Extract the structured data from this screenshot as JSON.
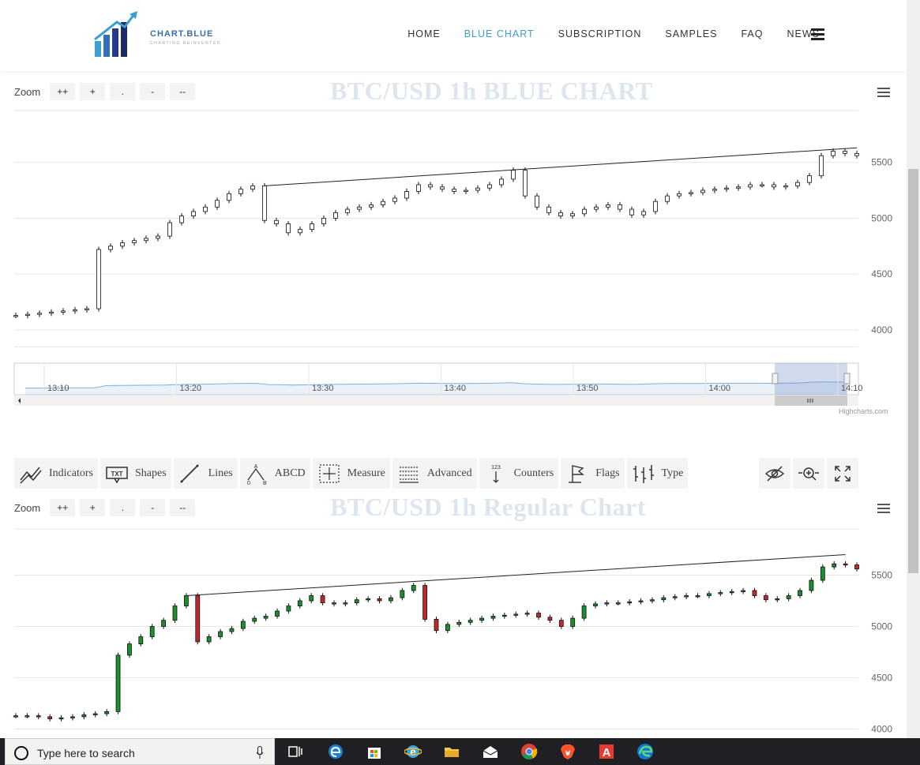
{
  "nav": {
    "logo_text": "CHART.BLUE",
    "logo_tagline": "CHARTING REINVENTED",
    "items": [
      {
        "label": "HOME",
        "active": false
      },
      {
        "label": "BLUE CHART",
        "active": true
      },
      {
        "label": "SUBSCRIPTION",
        "active": false
      },
      {
        "label": "SAMPLES",
        "active": false
      },
      {
        "label": "FAQ",
        "active": false
      },
      {
        "label": "NEWS",
        "active": false
      }
    ]
  },
  "zoom": {
    "label": "Zoom",
    "buttons": [
      "++",
      "+",
      ".",
      "-",
      "--"
    ]
  },
  "toolbar": {
    "items": [
      {
        "label": "Indicators",
        "icon": "indicators-icon"
      },
      {
        "label": "Shapes",
        "icon": "shapes-txt-icon",
        "icon_text": "TXT"
      },
      {
        "label": "Lines",
        "icon": "line-icon"
      },
      {
        "label": "ABCD",
        "icon": "abcd-icon"
      },
      {
        "label": "Measure",
        "icon": "measure-icon"
      },
      {
        "label": "Advanced",
        "icon": "advanced-icon"
      },
      {
        "label": "Counters",
        "icon": "counters-icon",
        "icon_text": "123"
      },
      {
        "label": "Flags",
        "icon": "flag-icon"
      },
      {
        "label": "Type",
        "icon": "type-icon"
      }
    ],
    "right_icons": [
      "hide-icon",
      "zoom-in-icon",
      "fullscreen-icon"
    ]
  },
  "credits": "Highcharts.com",
  "taskbar": {
    "search_placeholder": "Type here to search"
  },
  "chart_data": [
    {
      "type": "line",
      "title": "BTC/USD 1h BLUE CHART",
      "yticks": [
        4000,
        4500,
        5000,
        5500
      ],
      "ylim": [
        3950,
        5950
      ],
      "grid": true,
      "navigator_ticks": [
        "13:10",
        "13:20",
        "13:30",
        "13:40",
        "13:50",
        "14:00",
        "14:10"
      ],
      "series": [
        {
          "values": [
            4130,
            4140,
            4150,
            4160,
            4170,
            4180,
            4190,
            4720,
            4750,
            4780,
            4800,
            4820,
            4840,
            4960,
            5020,
            5060,
            5100,
            5160,
            5220,
            5260,
            5290,
            4980,
            4950,
            4870,
            4900,
            4950,
            5000,
            5050,
            5080,
            5100,
            5120,
            5150,
            5180,
            5240,
            5300,
            5280,
            5260,
            5240,
            5250,
            5270,
            5300,
            5350,
            5430,
            5200,
            5100,
            5050,
            5020,
            5040,
            5080,
            5100,
            5120,
            5080,
            5030,
            5060,
            5150,
            5200,
            5220,
            5230,
            5250,
            5260,
            5270,
            5280,
            5300,
            5300,
            5280,
            5290,
            5320,
            5380,
            5560,
            5600,
            5580,
            5560
          ]
        }
      ],
      "trendline": [
        {
          "x": 21,
          "y": 5290
        },
        {
          "x": 71,
          "y": 5630
        }
      ]
    },
    {
      "type": "line",
      "title": "BTC/USD 1h Regular Chart",
      "yticks": [
        4000,
        4500,
        5000,
        5500
      ],
      "ylim": [
        3950,
        5950
      ],
      "grid": true,
      "series": [
        {
          "values": [
            4130,
            4130,
            4120,
            4100,
            4110,
            4120,
            4140,
            4150,
            4170,
            4720,
            4830,
            4900,
            5000,
            5060,
            5200,
            5300,
            4850,
            4900,
            4950,
            4980,
            5050,
            5080,
            5100,
            5150,
            5200,
            5250,
            5300,
            5230,
            5220,
            5230,
            5260,
            5270,
            5250,
            5280,
            5350,
            5400,
            5070,
            4960,
            5020,
            5040,
            5060,
            5080,
            5100,
            5110,
            5120,
            5130,
            5090,
            5060,
            5000,
            5080,
            5200,
            5220,
            5230,
            5230,
            5240,
            5250,
            5260,
            5280,
            5290,
            5300,
            5300,
            5320,
            5330,
            5340,
            5350,
            5300,
            5260,
            5270,
            5300,
            5350,
            5450,
            5580,
            5610,
            5600,
            5560
          ]
        }
      ],
      "trendline": [
        {
          "x": 15,
          "y": 5300
        },
        {
          "x": 73,
          "y": 5700
        }
      ]
    }
  ]
}
